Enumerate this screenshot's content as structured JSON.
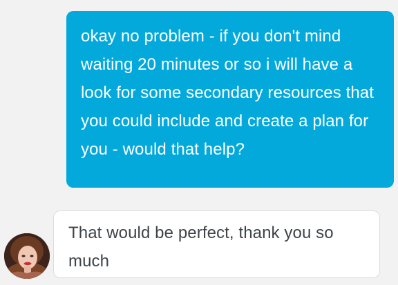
{
  "messages": [
    {
      "direction": "outgoing",
      "text": "okay no problem - if you don't mind waiting 20 minutes or so i will have a look for some secondary resources that you could include and create a plan for you - would that help?"
    },
    {
      "direction": "incoming",
      "text": "That would be perfect, thank you so much"
    }
  ],
  "colors": {
    "outgoing_bubble": "#04a9dc",
    "incoming_bubble": "#ffffff",
    "background": "#f2f2f2",
    "incoming_text": "#3f4449"
  },
  "avatar": {
    "icon": "user-photo-avatar"
  }
}
